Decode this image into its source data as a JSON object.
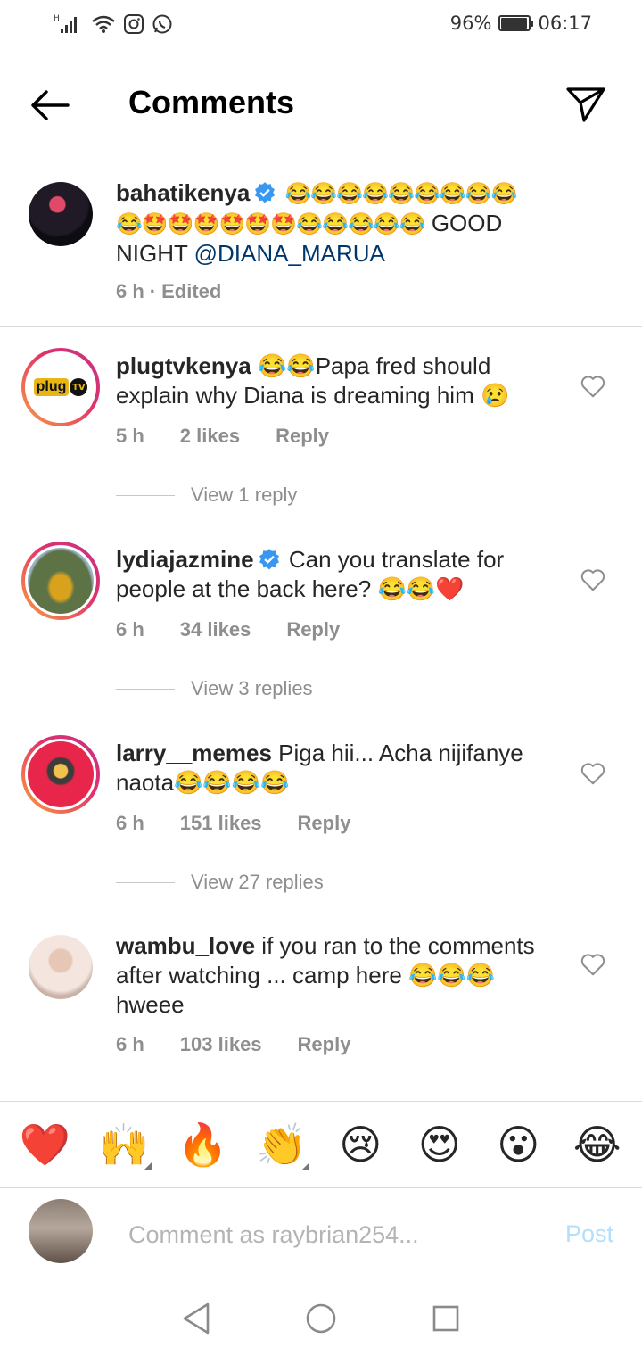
{
  "status_bar": {
    "battery": "96%",
    "time": "06:17",
    "battery_level": 0.96,
    "icons": [
      "signal-icon",
      "wifi-icon",
      "instagram-icon",
      "whatsapp-icon"
    ]
  },
  "header": {
    "title": "Comments",
    "back_icon": "arrow-left-icon",
    "share_icon": "paper-plane-icon"
  },
  "caption": {
    "username": "bahatikenya",
    "verified": true,
    "emoji_line": "😂😂😂😂😂😂😂😂😂",
    "emoji_line2": "😂🤩🤩🤩🤩🤩🤩😂😂😂😂😂",
    "text": " GOOD NIGHT ",
    "mention": "@DIANA_MARUA",
    "time": "6 h",
    "separator": "·",
    "edited": "Edited"
  },
  "comments": [
    {
      "username": "plugtvkenya",
      "verified": false,
      "text": "😂😂Papa fred should explain why Diana is dreaming him 😢",
      "time": "5 h",
      "likes": "2 likes",
      "reply_label": "Reply",
      "view_replies": "View 1 reply"
    },
    {
      "username": "lydiajazmine",
      "verified": true,
      "text": "Can you translate for people at the back here? 😂😂❤️",
      "time": "6 h",
      "likes": "34 likes",
      "reply_label": "Reply",
      "view_replies": "View 3 replies"
    },
    {
      "username": "larry__memes",
      "verified": false,
      "text": "Piga hii... Acha nijifanye naota😂😂😂😂",
      "time": "6 h",
      "likes": "151 likes",
      "reply_label": "Reply",
      "view_replies": "View 27 replies"
    },
    {
      "username": "wambu_love",
      "verified": false,
      "text": "if you ran to the comments after watching ... camp here 😂😂😂 hweee",
      "time": "6 h",
      "likes": "103 likes",
      "reply_label": "Reply"
    }
  ],
  "plug_logo_text": "plug",
  "plug_logo_tv": "TV",
  "emoji_bar": [
    "❤️",
    "🙌",
    "🔥",
    "👏",
    "😢",
    "😍",
    "😮",
    "😂"
  ],
  "composer": {
    "placeholder": "Comment as raybrian254...",
    "post_label": "Post"
  },
  "colors": {
    "accent_link": "#00376b",
    "post_disabled": "#b2dffc",
    "meta_gray": "#8e8e8e",
    "verified_blue": "#3897f0"
  }
}
